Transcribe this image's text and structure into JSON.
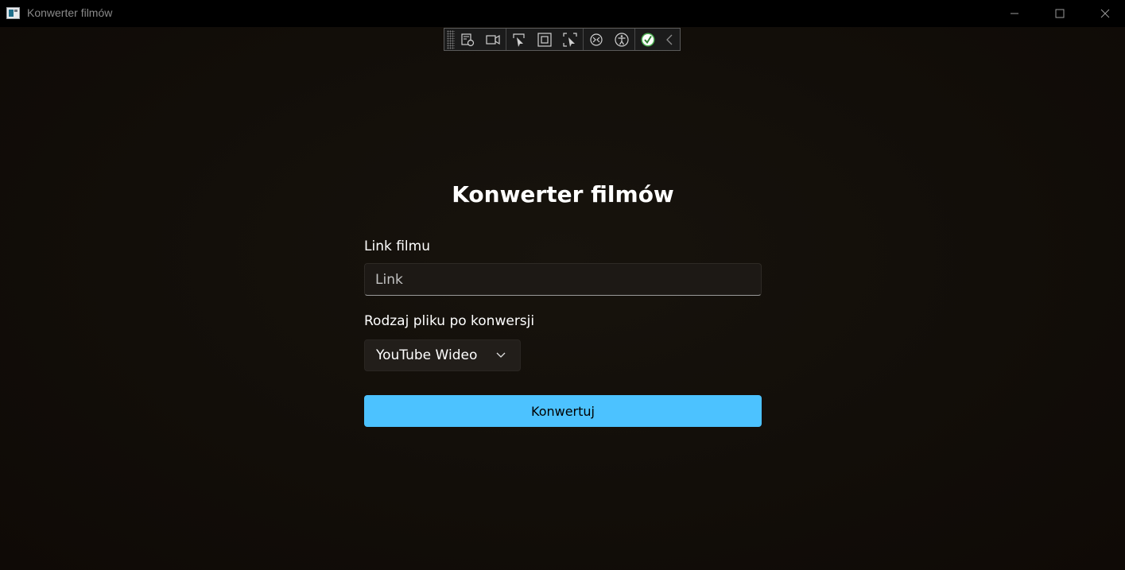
{
  "window": {
    "title": "Konwerter filmów",
    "controls": {
      "minimize_icon": "minimize-icon",
      "maximize_icon": "maximize-icon",
      "close_icon": "close-icon"
    }
  },
  "debug_toolbar": {
    "icons": [
      "live-visual-tree-icon",
      "record-icon",
      "select-element-icon",
      "display-layout-adorners-icon",
      "track-focus-icon",
      "binding-failures-icon",
      "accessibility-icon",
      "checkmark-icon",
      "collapse-chevron-icon"
    ],
    "check_color": "#4caf50"
  },
  "form": {
    "heading": "Konwerter filmów",
    "link_label": "Link filmu",
    "link_placeholder": "Link",
    "link_value": "",
    "type_label": "Rodzaj pliku po konwersji",
    "type_selected": "YouTube Wideo",
    "convert_label": "Konwertuj"
  },
  "colors": {
    "accent": "#4cc2ff",
    "background": "#120e09",
    "titlebar": "#000000"
  }
}
